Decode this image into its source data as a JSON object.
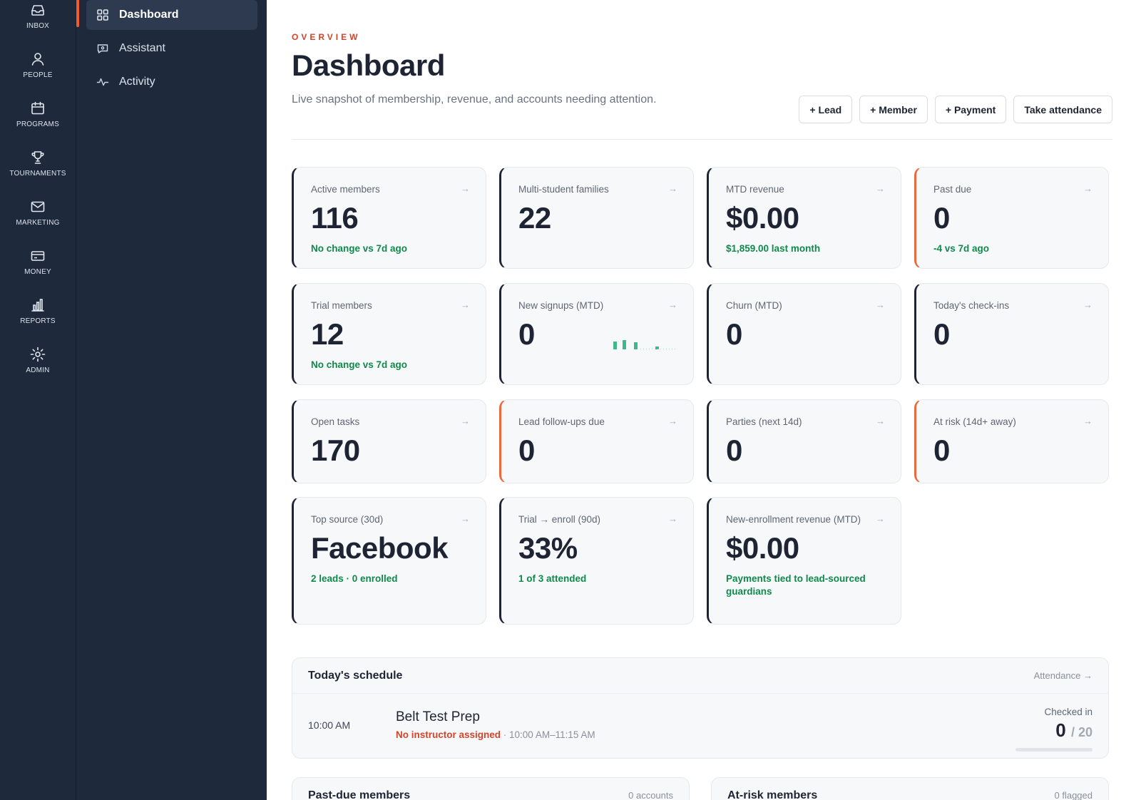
{
  "rail": {
    "items": [
      {
        "label": "INBOX",
        "icon": "inbox-icon"
      },
      {
        "label": "PEOPLE",
        "icon": "person-icon"
      },
      {
        "label": "PROGRAMS",
        "icon": "calendar-icon"
      },
      {
        "label": "TOURNAMENTS",
        "icon": "trophy-icon"
      },
      {
        "label": "MARKETING",
        "icon": "mail-icon"
      },
      {
        "label": "MONEY",
        "icon": "credit-card-icon"
      },
      {
        "label": "REPORTS",
        "icon": "bar-chart-icon"
      },
      {
        "label": "ADMIN",
        "icon": "sun-gear-icon"
      }
    ]
  },
  "subnav": {
    "items": [
      {
        "label": "Dashboard",
        "icon": "grid-icon",
        "active": true
      },
      {
        "label": "Assistant",
        "icon": "chat-icon",
        "active": false
      },
      {
        "label": "Activity",
        "icon": "pulse-icon",
        "active": false
      }
    ]
  },
  "header": {
    "eyebrow": "OVERVIEW",
    "title": "Dashboard",
    "subtitle": "Live snapshot of membership, revenue, and accounts needing attention.",
    "actions": [
      "+ Lead",
      "+ Member",
      "+ Payment",
      "Take attendance"
    ]
  },
  "cards": [
    {
      "label": "Active members",
      "value": "116",
      "note": "No change vs 7d ago"
    },
    {
      "label": "Multi-student families",
      "value": "22",
      "note": ""
    },
    {
      "label": "MTD revenue",
      "value": "$0.00",
      "note": "$1,859.00 last month"
    },
    {
      "label": "Past due",
      "value": "0",
      "note": "-4 vs 7d ago"
    },
    {
      "label": "Trial members",
      "value": "12",
      "note": "No change vs 7d ago"
    },
    {
      "label": "New signups (MTD)",
      "value": "0",
      "note": ""
    },
    {
      "label": "Churn (MTD)",
      "value": "0",
      "note": ""
    },
    {
      "label": "Today's check-ins",
      "value": "0",
      "note": ""
    },
    {
      "label": "Open tasks",
      "value": "170",
      "note": ""
    },
    {
      "label": "Lead follow-ups due",
      "value": "0",
      "note": ""
    },
    {
      "label": "Parties (next 14d)",
      "value": "0",
      "note": ""
    },
    {
      "label": "At risk (14d+ away)",
      "value": "0",
      "note": ""
    },
    {
      "label": "Top source (30d)",
      "value": "Facebook",
      "note": "2 leads · 0 enrolled"
    },
    {
      "label": "Trial → enroll (90d)",
      "value": "33%",
      "note": "1 of 3 attended"
    },
    {
      "label": "New-enrollment revenue (MTD)",
      "value": "$0.00",
      "note": "Payments tied to lead-sourced guardians"
    }
  ],
  "arrow": "→",
  "colors": {
    "sidebar": "#1e293b",
    "accent": "#ef5a2f",
    "alert_border": "#ea6a3c",
    "positive": "#0f8a4a",
    "warning_text": "#d4442a"
  },
  "schedule": {
    "title": "Today's schedule",
    "link": "Attendance →",
    "row": {
      "time": "10:00 AM",
      "name": "Belt Test Prep",
      "warning": "No instructor assigned",
      "separator": " · ",
      "range": "10:00 AM–11:15 AM",
      "checked_label": "Checked in",
      "checked_count": "0",
      "checked_total": "/ 20",
      "progress": 0
    }
  },
  "past_due_panel": {
    "title": "Past-due members",
    "count": "0 accounts"
  },
  "at_risk_panel": {
    "title": "At-risk members",
    "count": "0 flagged"
  }
}
